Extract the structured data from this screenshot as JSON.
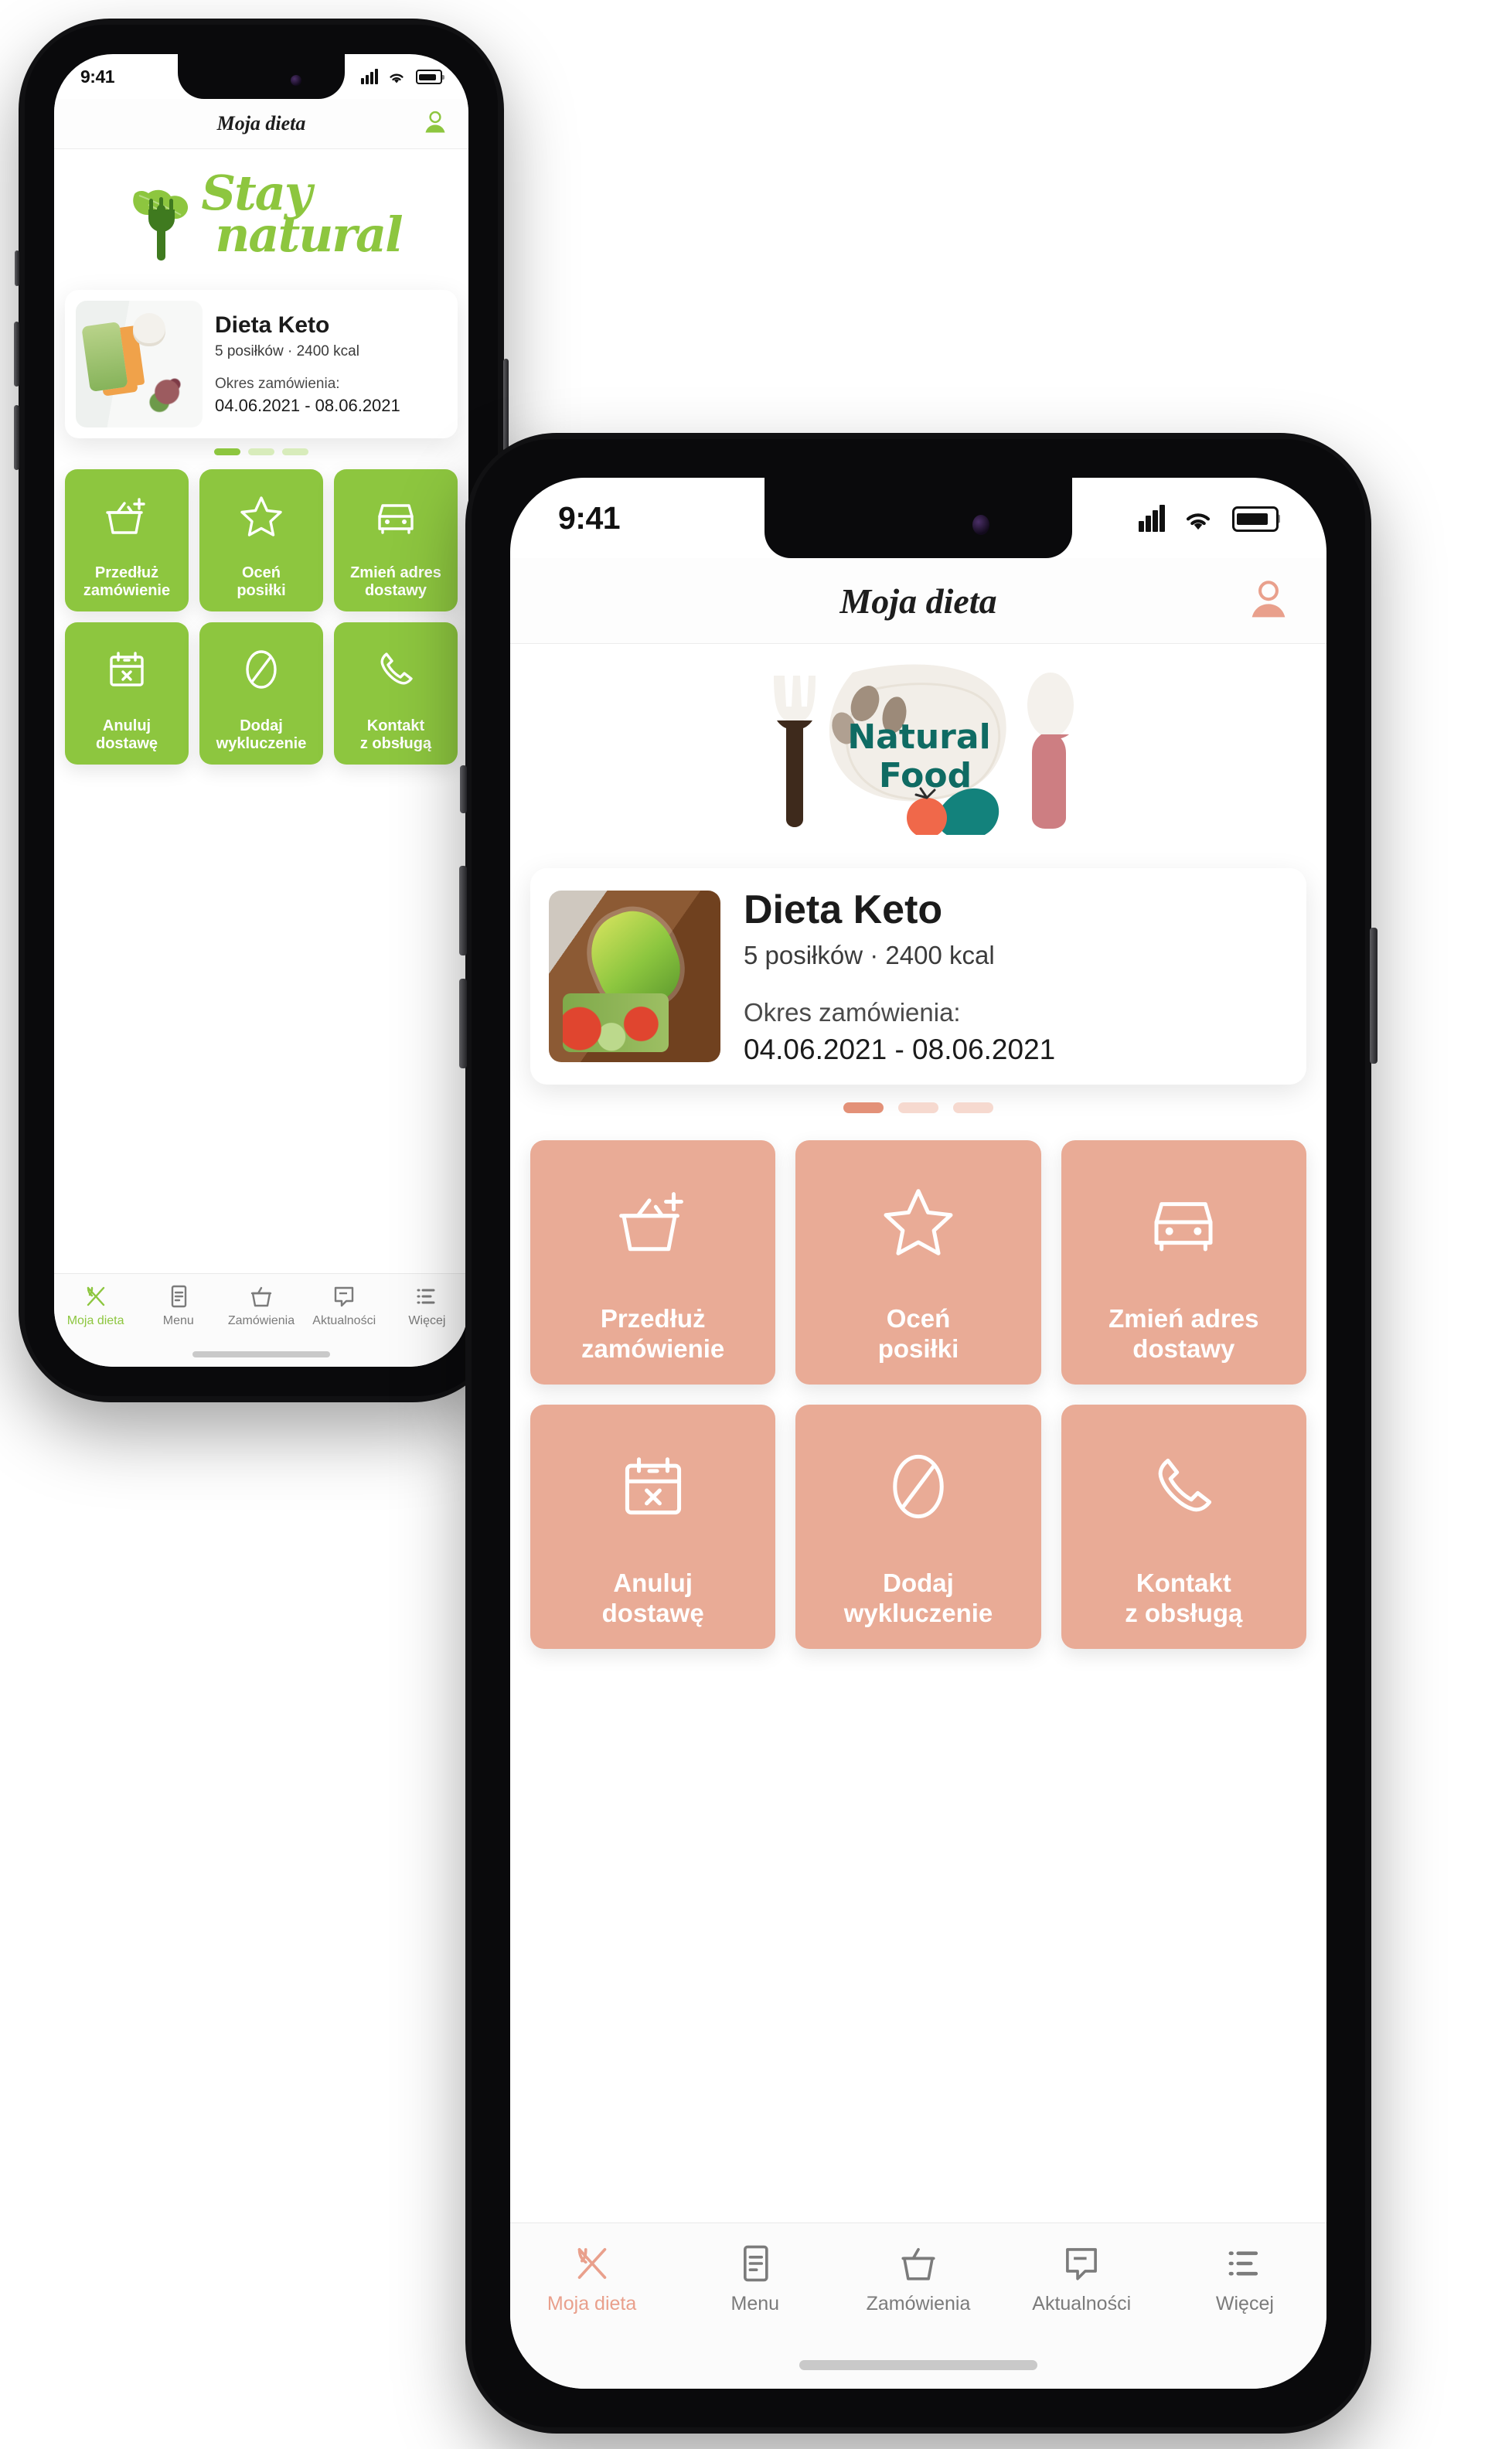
{
  "meta": {
    "accent_green": "#8dc63f",
    "accent_salmon": "#e9ab96",
    "salmon_text": "#e9a08c",
    "gray_text": "#7b7b7b"
  },
  "phone_back": {
    "status": {
      "time": "9:41",
      "signal_icon": "cellular-signal-icon",
      "wifi_icon": "wifi-icon",
      "battery_icon": "battery-icon"
    },
    "header": {
      "title": "Moja dieta",
      "avatar_icon": "user-avatar-icon"
    },
    "brand": {
      "name": "Stay natural",
      "word1": "Stay",
      "word2": "natural",
      "icon": "leaf-fork-icon"
    },
    "card": {
      "title": "Dieta Keto",
      "subtitle": "5 posiłków · 2400 kcal",
      "period_label": "Okres zamówienia:",
      "period_value": "04.06.2021 - 08.06.2021",
      "photo_alt": "lunchbox-meal-photo"
    },
    "carousel": {
      "dots": 3,
      "active": 0
    },
    "tiles": [
      {
        "label": "Przedłuż\nzamówienie",
        "icon": "basket-plus-icon"
      },
      {
        "label": "Oceń\nposiłki",
        "icon": "star-icon"
      },
      {
        "label": "Zmień adres\ndostawy",
        "icon": "car-icon"
      },
      {
        "label": "Anuluj\ndostawę",
        "icon": "calendar-x-icon"
      },
      {
        "label": "Dodaj\nwykluczenie",
        "icon": "no-entry-icon"
      },
      {
        "label": "Kontakt\nz obsługą",
        "icon": "phone-icon"
      }
    ],
    "tabs": [
      {
        "label": "Moja dieta",
        "icon": "crossed-cutlery-icon",
        "active": true
      },
      {
        "label": "Menu",
        "icon": "document-list-icon",
        "active": false
      },
      {
        "label": "Zamówienia",
        "icon": "basket-icon",
        "active": false
      },
      {
        "label": "Aktualności",
        "icon": "speech-bubble-icon",
        "active": false
      },
      {
        "label": "Więcej",
        "icon": "list-icon",
        "active": false
      }
    ]
  },
  "phone_front": {
    "status": {
      "time": "9:41",
      "signal_icon": "cellular-signal-icon",
      "wifi_icon": "wifi-icon",
      "battery_icon": "battery-icon"
    },
    "header": {
      "title": "Moja dieta",
      "avatar_icon": "user-avatar-icon"
    },
    "brand": {
      "name": "Natural Food",
      "word1": "Natural",
      "word2": "Food",
      "icon": "plate-cutlery-icon"
    },
    "card": {
      "title": "Dieta Keto",
      "subtitle": "5 posiłków · 2400 kcal",
      "period_label": "Okres zamówienia:",
      "period_value": "04.06.2021 - 08.06.2021",
      "photo_alt": "keto-lunchbox-photo"
    },
    "carousel": {
      "dots": 3,
      "active": 0
    },
    "tiles": [
      {
        "label_line1": "Przedłuż",
        "label_line2": "zamówienie",
        "icon": "basket-plus-icon"
      },
      {
        "label_line1": "Oceń",
        "label_line2": "posiłki",
        "icon": "star-icon"
      },
      {
        "label_line1": "Zmień adres",
        "label_line2": "dostawy",
        "icon": "car-icon"
      },
      {
        "label_line1": "Anuluj",
        "label_line2": "dostawę",
        "icon": "calendar-x-icon"
      },
      {
        "label_line1": "Dodaj",
        "label_line2": "wykluczenie",
        "icon": "no-entry-icon"
      },
      {
        "label_line1": "Kontakt",
        "label_line2": "z obsługą",
        "icon": "phone-icon"
      }
    ],
    "tabs": [
      {
        "label": "Moja dieta",
        "icon": "crossed-cutlery-icon",
        "active": true
      },
      {
        "label": "Menu",
        "icon": "document-list-icon",
        "active": false
      },
      {
        "label": "Zamówienia",
        "icon": "basket-icon",
        "active": false
      },
      {
        "label": "Aktualności",
        "icon": "speech-bubble-icon",
        "active": false
      },
      {
        "label": "Więcej",
        "icon": "list-icon",
        "active": false
      }
    ]
  }
}
